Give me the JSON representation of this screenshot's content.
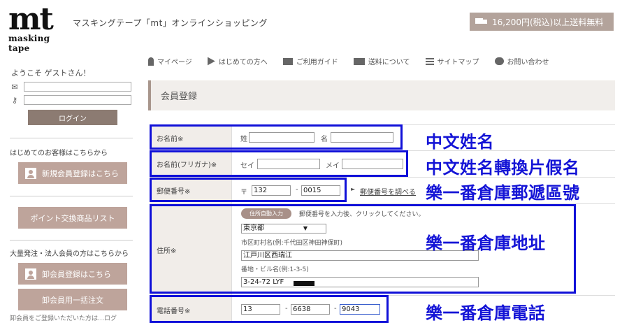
{
  "header": {
    "logo_main": "mt",
    "logo_sub": "masking tape",
    "site_title": "マスキングテープ「mt」オンラインショッピング",
    "shipping_notice": "16,200円(税込)以上送料無料"
  },
  "nav": [
    {
      "label": "マイページ",
      "icon": "person-icon"
    },
    {
      "label": "はじめての方へ",
      "icon": "arrow-icon"
    },
    {
      "label": "ご利用ガイド",
      "icon": "book-icon"
    },
    {
      "label": "送料について",
      "icon": "truck-icon"
    },
    {
      "label": "サイトマップ",
      "icon": "list-icon"
    },
    {
      "label": "お問い合わせ",
      "icon": "speech-bubble-icon"
    }
  ],
  "sidebar": {
    "welcome": "ようこそ ゲストさん！",
    "login_button": "ログイン",
    "first_time_heading": "はじめてのお客様はこちらから",
    "register_button": "新規会員登録はこちら",
    "points_button": "ポイント交換商品リスト",
    "bulk_heading": "大量発注・法人会員の方はこちらから",
    "wholesale_register_button": "卸会員登録はこちら",
    "wholesale_order_button": "卸会員用一括注文",
    "cut_text": "卸会員をご登録いただいた方は…ログ"
  },
  "page_title": "会員登録",
  "form": {
    "name": {
      "label": "お名前※",
      "sei_label": "姓",
      "mei_label": "名",
      "sei_value": "",
      "mei_value": ""
    },
    "furigana": {
      "label": "お名前(フリガナ)※",
      "sei_label": "セイ",
      "mei_label": "メイ",
      "sei_value": "",
      "mei_value": ""
    },
    "postal": {
      "label": "郵便番号※",
      "prefix": "〒",
      "part1": "132",
      "sep": "-",
      "part2": "0015",
      "lookup_link": "郵便番号を調べる"
    },
    "address": {
      "label": "住所※",
      "autofill_button": "住所自動入力",
      "instruction": "郵便番号を入力後、クリックしてください。",
      "prefecture": "東京都",
      "city_hint": "市区町村名(例:千代田区神田神保町)",
      "city_value": "江戸川区西瑞江",
      "street_hint": "番地・ビル名(例:1-3-5)",
      "street_value": "3-24-72 LYF"
    },
    "phone": {
      "label": "電話番号※",
      "part1": "13",
      "sep1": "-",
      "part2": "6638",
      "sep2": "-",
      "part3": "9043"
    }
  },
  "annotations": {
    "name": "中文姓名",
    "furigana": "中文姓名轉換片假名",
    "postal": "樂一番倉庫郵遞區號",
    "address": "樂一番倉庫地址",
    "phone": "樂一番倉庫電話"
  },
  "colors": {
    "annotation_blue": "#1414d6",
    "button_taupe": "#bea49b",
    "login_brown": "#8c7b72"
  }
}
